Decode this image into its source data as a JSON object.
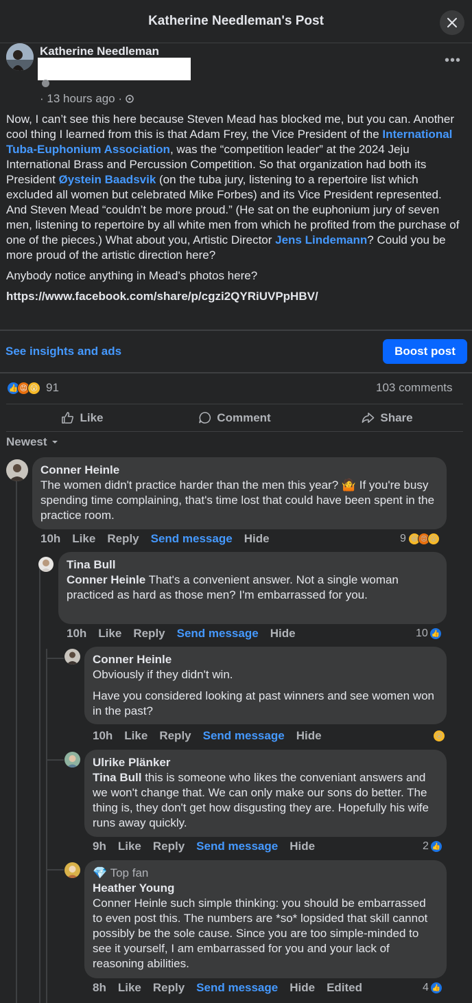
{
  "header": {
    "title": "Katherine Needleman's Post"
  },
  "post": {
    "author": "Katherine Needleman",
    "time": "· 13 hours ago ·",
    "p1_a": "Now, I can’t see this here because Steven Mead has blocked me, but you can. Another cool thing I learned from this is that Adam Frey, the Vice President of the ",
    "link_itea": "International Tuba-Euphonium Association",
    "p1_b": ", was the “competition leader” at the 2024 Jeju International Brass and Percussion Competition. So that organization had both its President ",
    "link_oystein": "Øystein Baadsvik",
    "p1_c": " (on the tuba jury, listening to a repertoire list which excluded all women but celebrated Mike Forbes) and its Vice President represented. And Steven Mead “couldn’t be more proud.”  (He sat on the euphonium jury of seven men, listening to repertoire by all white men from which he profited from the purchase of one of the pieces.) What about you, Artistic Director ",
    "link_jens": "Jens Lindemann",
    "p1_d": "? Could you be more proud of the artistic direction here?",
    "p2": "Anybody notice anything in Mead's photos here?",
    "url": "https://www.facebook.com/share/p/cgzi2QYRiUVPpHBV/"
  },
  "insights_label": "See insights and ads",
  "boost_label": "Boost post",
  "reactions": {
    "count": "91",
    "comments": "103 comments"
  },
  "actions": {
    "like": "Like",
    "comment": "Comment",
    "share": "Share"
  },
  "sort_label": "Newest",
  "comments": [
    {
      "name": "Conner Heinle",
      "text": "The women didn't practice harder than the men this year? 🤷 If you're busy spending time complaining, that's time lost that could have been spent in the practice room.",
      "time": "10h",
      "like": "Like",
      "reply": "Reply",
      "send": "Send message",
      "hide": "Hide",
      "react_count": "9"
    },
    {
      "name": "Tina Bull",
      "mention": "Conner Heinle",
      "text": " That's a convenient answer. Not a single woman practiced as hard as those men? I'm embarrassed for you.",
      "time": "10h",
      "like": "Like",
      "reply": "Reply",
      "send": "Send message",
      "hide": "Hide",
      "react_count": "10"
    },
    {
      "name": "Conner Heinle",
      "text1": "Obviously if they didn't win.",
      "text2": "Have you considered looking at past winners and see women won in the past?",
      "time": "10h",
      "like": "Like",
      "reply": "Reply",
      "send": "Send message",
      "hide": "Hide"
    },
    {
      "name": "Ulrike Plänker",
      "mention": "Tina Bull",
      "text": " this is someone who likes the conveniant answers and we won't change that. We can only make our sons do better. The thing is, they don't get how disgusting they are. Hopefully his wife runs away quickly.",
      "time": "9h",
      "like": "Like",
      "reply": "Reply",
      "send": "Send message",
      "hide": "Hide",
      "react_count": "2"
    },
    {
      "badge": "Top fan",
      "name": "Heather Young",
      "text": "Conner Heinle such simple thinking: you should be embarrassed to even post this. The numbers are *so* lopsided that skill cannot possibly be the sole cause. Since you are too simple-minded to see it yourself, I am embarrassed for you and your lack of reasoning abilities.",
      "time": "8h",
      "like": "Like",
      "reply": "Reply",
      "send": "Send message",
      "hide": "Hide",
      "edited": "Edited",
      "react_count": "4"
    }
  ]
}
